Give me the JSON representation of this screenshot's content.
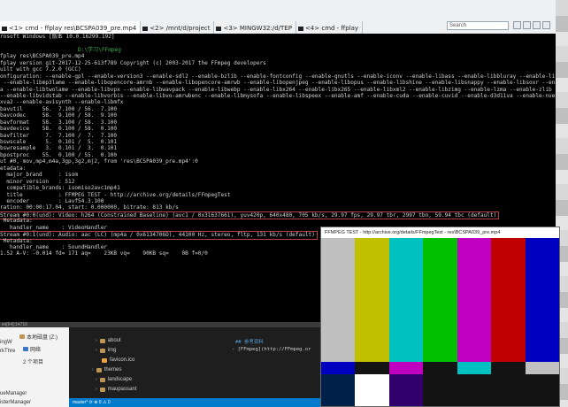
{
  "tabs": [
    {
      "label": "<1> cmd - ffplay  res\\BCSPA039_pre.mp4",
      "active": true
    },
    {
      "label": "<2> /mnt/d/project",
      "active": false
    },
    {
      "label": "<3> MINGW32:/d/TEP",
      "active": false
    },
    {
      "label": "<4> cmd - ffplay",
      "active": false
    }
  ],
  "search": {
    "placeholder": "Search"
  },
  "console": {
    "lines": [
      "rosoft Windows [版本 10.0.16299.192]",
      "",
      "D:\\学习\\FFmpeg",
      "fplay res\\BCSPA039_pre.mp4",
      "fplay version git-2017-12-25-613f789 Copyright (c) 2003-2017 the FFmpeg developers",
      "uilt with gcc 7.2.0 (GCC)",
      "onfiguration: --enable-gpl --enable-version3 --enable-sdl2 --enable-bzlib --enable-fontconfig --enable-gnutls --enable-iconv --enable-libass --enable-libbluray --enable-libfreetype",
      " --enable-libmp3lame --enable-libopencore-amrnb --enable-libopencore-amrwb --enable-libopenjpeg --enable-libopus --enable-libshine --enable-libsnappy --enable-libsoxr --enable-libthe",
      "a --enable-libtwolame --enable-libvpx --enable-libwavpack --enable-libwebp --enable-libx264 --enable-libx265 --enable-libxml2 --enable-libzimg --enable-lzma --enable-zlib --enable-gm",
      "--enable-libvidstab --enable-libvorbis --enable-libvo-amrwbenc --enable-libmysofa --enable-libspeex --enable-amf --enable-cuda --enable-cuvid --enable-d3d11va --enable-nvenc --enabl",
      "xva2 --enable-avisynth --enable-libmfx",
      "bavutil      56.  7.100 / 56.  7.100",
      "bavcodec     58.  9.100 / 58.  9.100",
      "bavformat    58.  3.100 / 58.  3.100",
      "bavdevice    58.  0.100 / 58.  0.100",
      "bavfilter     7.  7.100 /  7.  7.100",
      "bswscale      5.  0.101 /  5.  0.101",
      "bswresample   3.  0.101 /  3.  0.101",
      "bpostproc    55.  0.100 / 55.  0.100",
      "ut #0, mov,mp4,m4a,3gp,3g2,mj2, from 'res\\BCSPA039_pre.mp4':0",
      "etadata:",
      "  major_brand     : isom",
      "  minor_version   : 512",
      "  compatible_brands: isomiso2avc1mp41",
      "  title           : FFMPEG TEST - http://archive.org/details/FFmpegTest",
      "  encoder         : Lavf54.3.100",
      "ration: 00:00:17.04, start: 0.000000, bitrate: 813 kb/s",
      "Stream #0:0(und): Video: h264 (Constrained Baseline) (avc1 / 0x31637661), yuv420p, 640x480, 705 kb/s, 29.97 fps, 29.97 tbr, 2997 tbn, 59.94 tbc (default)",
      " Metadata:",
      "   handler_name    : VideoHandler",
      "Stream #0:1(und): Audio: aac (LC) (mp4a / 0x6134706D), 44100 Hz, stereo, fltp, 131 kb/s (default)",
      " Metadata:",
      "   handler_name    : SoundHandler",
      "1.52 A-V: -0.014 fd= 171 aq=    23KB vq=    90KB sq=    0B f=0/0"
    ]
  },
  "ide": {
    "top_label": "ex[64]:14716",
    "explorer": [
      {
        "label": "本地磁盘 (Z:)"
      },
      {
        "label": "网络"
      },
      {
        "label": "2 个项目"
      }
    ],
    "left_panel": [
      "ingW",
      "rkThre",
      "ueManager",
      "isterManager"
    ],
    "tree": [
      {
        "label": "about",
        "type": "folder"
      },
      {
        "label": "img",
        "type": "folder"
      },
      {
        "label": "favicon.ico",
        "type": "file"
      },
      {
        "label": "themes",
        "type": "folder"
      },
      {
        "label": "landscape",
        "type": "folder"
      },
      {
        "label": "maupassant",
        "type": "folder"
      }
    ],
    "editor": [
      {
        "num": "",
        "text": "## 参考资料"
      },
      {
        "num": "",
        "text": "- [FFmpeg](http://FFmpeg.or"
      }
    ],
    "status": "master*  ⟳  ⊗ 0 ⚠ 0"
  },
  "ffplay": {
    "title": "FFMPEG TEST - http://archive.org/details/FFmpegTest - res\\BCSPA039_pre.mp4",
    "bars_main": [
      "#c0c0c0",
      "#c0c000",
      "#00c0c0",
      "#00c000",
      "#c000c0",
      "#c00000",
      "#0000c0"
    ],
    "bars_mid": [
      "#0000c0",
      "#131313",
      "#c000c0",
      "#131313",
      "#00c0c0",
      "#131313",
      "#c0c0c0"
    ],
    "bars_low": [
      "#00214c",
      "#ffffff",
      "#32006a",
      "#131313",
      "#131313",
      "#131313",
      "#131313"
    ]
  }
}
